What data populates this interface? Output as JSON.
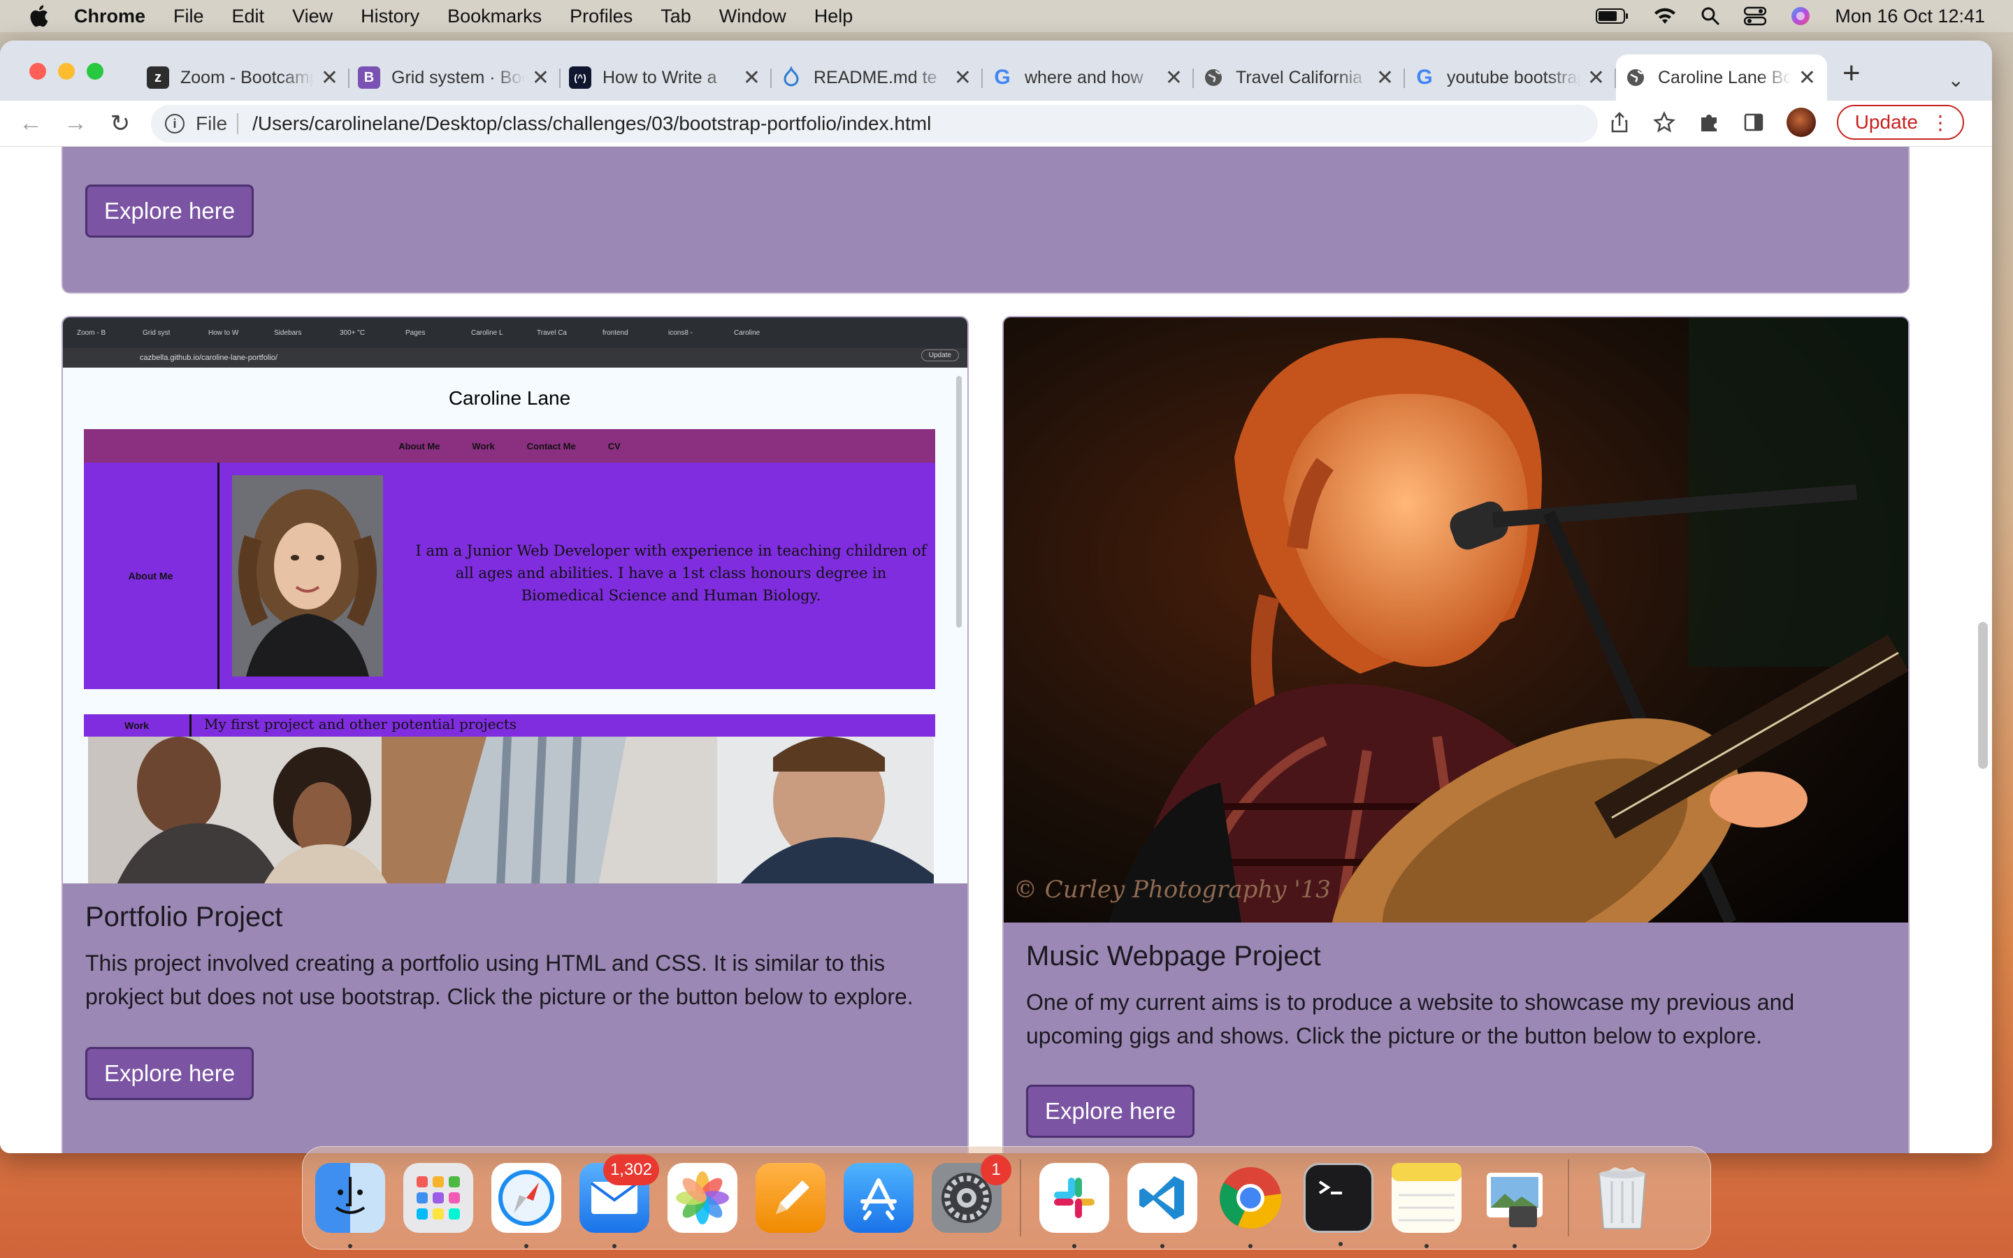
{
  "menubar": {
    "app_name": "Chrome",
    "items": [
      "File",
      "Edit",
      "View",
      "History",
      "Bookmarks",
      "Profiles",
      "Tab",
      "Window",
      "Help"
    ],
    "datetime": "Mon 16 Oct  12:41"
  },
  "browser": {
    "tabs": [
      {
        "title": "Zoom - Bootcamp",
        "favicon": "zoom-icon",
        "color": "#2d2d2d"
      },
      {
        "title": "Grid system · Bootstrap",
        "favicon": "bootstrap-icon",
        "color": "#7952b3"
      },
      {
        "title": "How to Write a",
        "favicon": "codecademy-icon",
        "color": "#10162f"
      },
      {
        "title": "README.md te",
        "favicon": "drupal-icon",
        "color": "#2f7dd1"
      },
      {
        "title": "where and how",
        "favicon": "google-icon",
        "color": "#ffffff"
      },
      {
        "title": "Travel California",
        "favicon": "globe-icon",
        "color": "#ffffff"
      },
      {
        "title": "youtube bootstrap",
        "favicon": "google-icon",
        "color": "#ffffff"
      },
      {
        "title": "Caroline Lane Bootstrap",
        "favicon": "globe-icon",
        "color": "#ffffff",
        "active": true
      }
    ],
    "url_protocol": "File",
    "url": "/Users/carolinelane/Desktop/class/challenges/03/bootstrap-portfolio/index.html",
    "update_label": "Update"
  },
  "page": {
    "top_card": {
      "button_label": "Explore here"
    },
    "portfolio_card": {
      "title": "Portfolio Project",
      "text": "This project involved creating a portfolio using HTML and CSS. It is similar to this prokject but does not use bootstrap. Click the picture or the button below to explore.",
      "button_label": "Explore here",
      "screenshot": {
        "mini_tabs": [
          "Zoom - B",
          "Grid syst",
          "How to W",
          "Sidebars",
          "300+ \"C",
          "Pages",
          "Caroline L",
          "Travel Ca",
          "frontend",
          "icons8 -",
          "Caroline"
        ],
        "mini_url": "cazbella.github.io/caroline-lane-portfolio/",
        "mini_update": "Update",
        "site_title": "Caroline Lane",
        "nav": [
          "About Me",
          "Work",
          "Contact Me",
          "CV"
        ],
        "about_label": "About Me",
        "about_text": "I am a Junior Web Developer with experience in teaching children of all ages and abilities. I have a 1st class honours degree in Biomedical Science and Human Biology.",
        "work_label": "Work",
        "work_text": "My first project and other potential projects"
      }
    },
    "music_card": {
      "title": "Music Webpage Project",
      "text": "One of my current aims is to produce a website to showcase my previous and upcoming gigs and shows. Click the picture or the button below to explore.",
      "button_label": "Explore here",
      "photo_watermark": "© Curley Photography '13"
    }
  },
  "dock": {
    "apps": [
      "Finder",
      "Launchpad",
      "Safari",
      "Mail",
      "Photos",
      "Pages",
      "App Store",
      "System Settings",
      "Slack",
      "Visual Studio Code",
      "Google Chrome",
      "Terminal",
      "Notes",
      "Preview",
      "Trash"
    ],
    "mail_badge": "1,302",
    "settings_badge": "1"
  }
}
